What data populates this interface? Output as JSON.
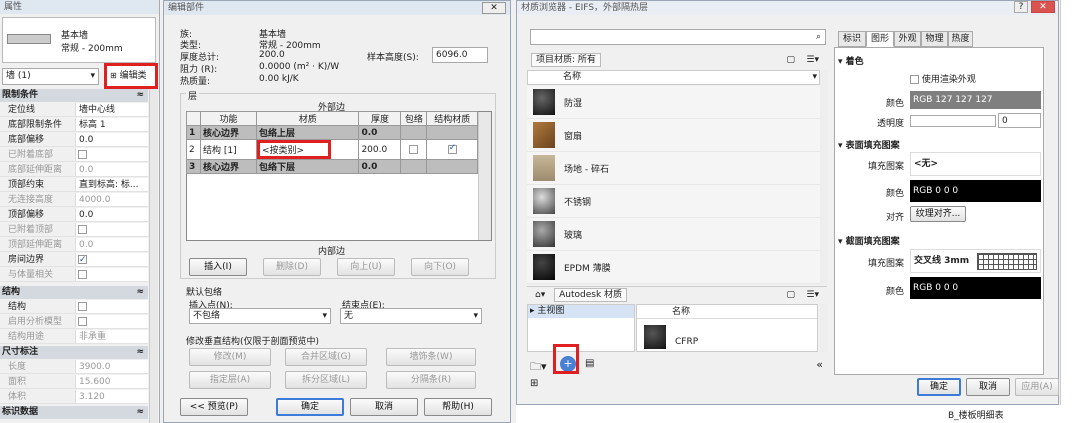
{
  "props": {
    "title": "属性",
    "type_line1": "基本墙",
    "type_line2": "常规 - 200mm",
    "selector": "墙 (1)",
    "edit_type": "编辑类型",
    "sections": {
      "constraints": "限制条件",
      "structure": "结构",
      "dimensions": "尺寸标注",
      "identity": "标识数据"
    },
    "rows": [
      {
        "k": "定位线",
        "v": "墙中心线"
      },
      {
        "k": "底部限制条件",
        "v": "标高 1"
      },
      {
        "k": "底部偏移",
        "v": "0.0"
      },
      {
        "k": "已附着底部",
        "v": ""
      },
      {
        "k": "底部延伸距离",
        "v": "0.0"
      },
      {
        "k": "顶部约束",
        "v": "直到标高: 标..."
      },
      {
        "k": "无连接高度",
        "v": "4000.0"
      },
      {
        "k": "顶部偏移",
        "v": "0.0"
      },
      {
        "k": "已附着顶部",
        "v": ""
      },
      {
        "k": "顶部延伸距离",
        "v": "0.0"
      },
      {
        "k": "房间边界",
        "v": ""
      },
      {
        "k": "与体量相关",
        "v": ""
      }
    ],
    "struct_rows": [
      {
        "k": "结构",
        "v": ""
      },
      {
        "k": "启用分析模型",
        "v": ""
      },
      {
        "k": "结构用途",
        "v": "非承重"
      }
    ],
    "dim_rows": [
      {
        "k": "长度",
        "v": "3900.0"
      },
      {
        "k": "面积",
        "v": "15.600"
      },
      {
        "k": "体积",
        "v": "3.120"
      }
    ]
  },
  "edit": {
    "title": "编辑部件",
    "family_k": "族:",
    "family_v": "基本墙",
    "type_k": "类型:",
    "type_v": "常规 - 200mm",
    "thick_k": "厚度总计:",
    "thick_v": "200.0",
    "res_k": "阻力 (R):",
    "res_v": "0.0000 (m² · K)/W",
    "mass_k": "热质量:",
    "mass_v": "0.00 kJ/K",
    "sample_k": "样本高度(S):",
    "sample_v": "6096.0",
    "layers_label": "层",
    "exterior": "外部边",
    "interior": "内部边",
    "cols": [
      "功能",
      "材质",
      "厚度",
      "包络",
      "结构材质"
    ],
    "rows": [
      {
        "n": "1",
        "f": "核心边界",
        "m": "包络上层",
        "t": "0.0"
      },
      {
        "n": "2",
        "f": "结构 [1]",
        "m": "<按类别>",
        "t": "200.0"
      },
      {
        "n": "3",
        "f": "核心边界",
        "m": "包络下层",
        "t": "0.0"
      }
    ],
    "insert": "插入(I)",
    "delete": "删除(D)",
    "up": "向上(U)",
    "down": "向下(O)",
    "wrap_label": "默认包络",
    "insert_pt": "插入点(N):",
    "insert_val": "不包络",
    "end_pt": "结束点(E):",
    "end_val": "无",
    "modify_label": "修改垂直结构(仅限于剖面预览中)",
    "modify": "修改(M)",
    "merge": "合并区域(G)",
    "sweep": "墙饰条(W)",
    "assign": "指定层(A)",
    "split": "拆分区域(L)",
    "reveal": "分隔条(R)",
    "preview": "<< 预览(P)",
    "ok": "确定",
    "cancel": "取消",
    "help": "帮助(H)",
    "close": "✕"
  },
  "mat": {
    "title": "材质浏览器 - EIFS，外部隔热层",
    "search_placeholder": "",
    "project_mat": "项目材质: 所有",
    "name_col": "名称",
    "items": [
      {
        "name": "防湿"
      },
      {
        "name": "窗扇"
      },
      {
        "name": "场地 - 碎石"
      },
      {
        "name": "不锈钢"
      },
      {
        "name": "玻璃"
      },
      {
        "name": "EPDM 薄膜"
      }
    ],
    "lib_path": "Autodesk 材质",
    "tree_main": "主视图",
    "lib_name_col": "名称",
    "lib_item": "CFRP",
    "tabs": [
      "标识",
      "图形",
      "外观",
      "物理",
      "热度"
    ],
    "shading": "着色",
    "use_render": "使用渲染外观",
    "color_k": "颜色",
    "color_v": "RGB 127 127 127",
    "trans_k": "透明度",
    "trans_v": "0",
    "surface": "表面填充图案",
    "fill_k": "填充图案",
    "fill_v": "<无>",
    "scolor_v": "RGB 0 0 0",
    "align_k": "对齐",
    "align_v": "纹理对齐...",
    "cut": "截面填充图案",
    "cfill_v": "交叉线 3mm",
    "ccolor_v": "RGB 0 0 0",
    "ok": "确定",
    "cancel": "取消",
    "apply": "应用(A)",
    "help": "?",
    "close": "✕",
    "tree_bottom": "B_楼板明细表"
  }
}
